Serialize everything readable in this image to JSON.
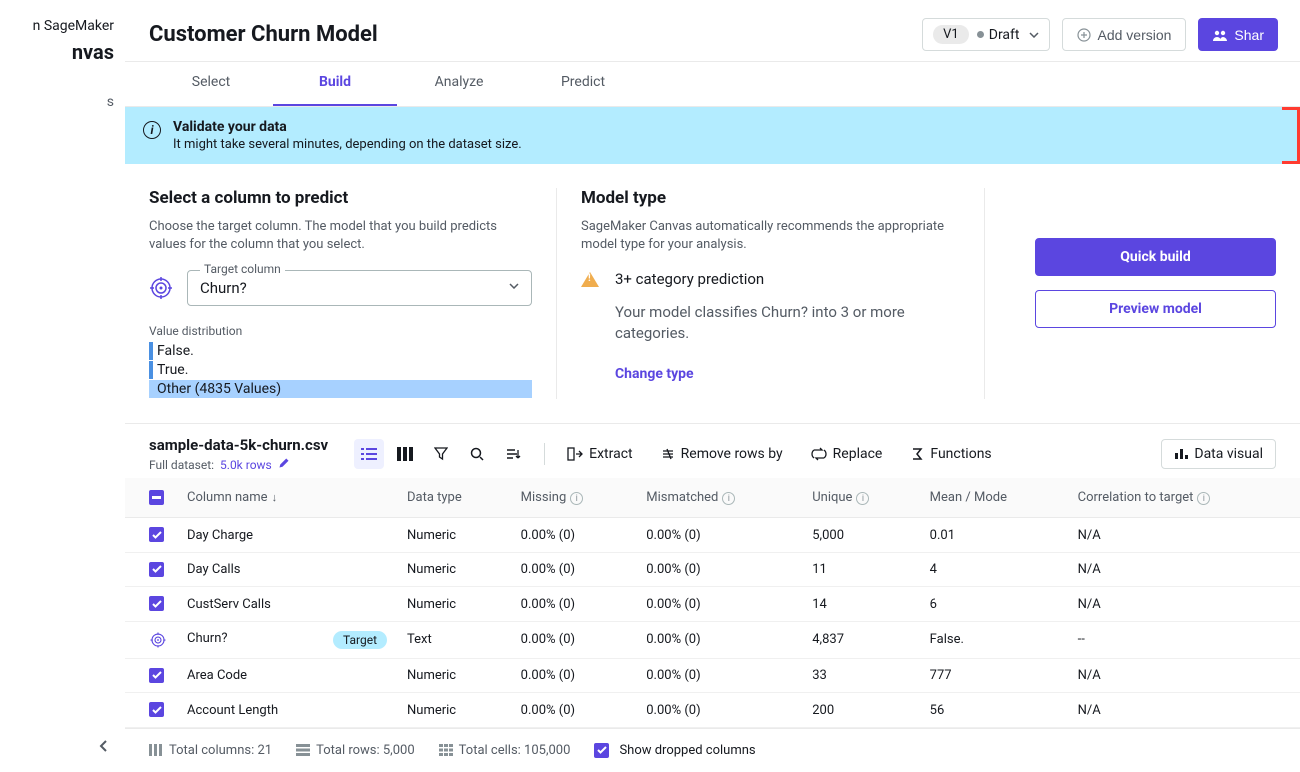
{
  "sidebar": {
    "product": "n SageMaker",
    "brand": "nvas",
    "items": [
      "",
      "s",
      ""
    ]
  },
  "header": {
    "title": "Customer Churn Model",
    "version": "V1",
    "status": "Draft",
    "add_version": "Add version",
    "share": "Shar"
  },
  "tabs": {
    "select": "Select",
    "build": "Build",
    "analyze": "Analyze",
    "predict": "Predict"
  },
  "banner": {
    "title": "Validate your data",
    "sub": "It might take several minutes, depending on the dataset size."
  },
  "predictCol": {
    "title": "Select a column to predict",
    "help": "Choose the target column. The model that you build predicts values for the column that you select.",
    "fieldLabel": "Target column",
    "fieldValue": "Churn?",
    "vdLabel": "Value distribution",
    "vd": [
      {
        "label": "False.",
        "bar": 1,
        "dark": 1
      },
      {
        "label": "True.",
        "bar": 1,
        "dark": 1
      },
      {
        "label": "Other (4835 Values)",
        "bar": 100,
        "dark": 0
      }
    ]
  },
  "modelType": {
    "title": "Model type",
    "help": "SageMaker Canvas automatically recommends the appropriate model type for your analysis.",
    "warning": "3+ category prediction",
    "desc": "Your model classifies Churn? into 3 or more categories.",
    "change": "Change type"
  },
  "actions": {
    "quick": "Quick build",
    "preview": "Preview model"
  },
  "dataset": {
    "name": "sample-data-5k-churn.csv",
    "fullLabel": "Full dataset:",
    "rows": "5.0k rows"
  },
  "toolbar": {
    "extract": "Extract",
    "remove": "Remove rows by",
    "replace": "Replace",
    "functions": "Functions",
    "viz": "Data visual"
  },
  "tableHeaders": {
    "col": "Column name",
    "dtype": "Data type",
    "missing": "Missing",
    "mismatch": "Mismatched",
    "unique": "Unique",
    "mean": "Mean / Mode",
    "corr": "Correlation to target"
  },
  "rows": [
    {
      "name": "Day Charge",
      "dtype": "Numeric",
      "missing": "0.00% (0)",
      "mismatch": "0.00% (0)",
      "unique": "5,000",
      "mean": "0.01",
      "corr": "N/A",
      "target": false
    },
    {
      "name": "Day Calls",
      "dtype": "Numeric",
      "missing": "0.00% (0)",
      "mismatch": "0.00% (0)",
      "unique": "11",
      "mean": "4",
      "corr": "N/A",
      "target": false
    },
    {
      "name": "CustServ Calls",
      "dtype": "Numeric",
      "missing": "0.00% (0)",
      "mismatch": "0.00% (0)",
      "unique": "14",
      "mean": "6",
      "corr": "N/A",
      "target": false
    },
    {
      "name": "Churn?",
      "dtype": "Text",
      "missing": "0.00% (0)",
      "mismatch": "0.00% (0)",
      "unique": "4,837",
      "mean": "False.",
      "corr": "--",
      "target": true,
      "badge": "Target"
    },
    {
      "name": "Area Code",
      "dtype": "Numeric",
      "missing": "0.00% (0)",
      "mismatch": "0.00% (0)",
      "unique": "33",
      "mean": "777",
      "corr": "N/A",
      "target": false
    },
    {
      "name": "Account Length",
      "dtype": "Numeric",
      "missing": "0.00% (0)",
      "mismatch": "0.00% (0)",
      "unique": "200",
      "mean": "56",
      "corr": "N/A",
      "target": false
    }
  ],
  "footer": {
    "cols": "Total columns: 21",
    "rows": "Total rows: 5,000",
    "cells": "Total cells: 105,000",
    "dropped": "Show dropped columns"
  }
}
